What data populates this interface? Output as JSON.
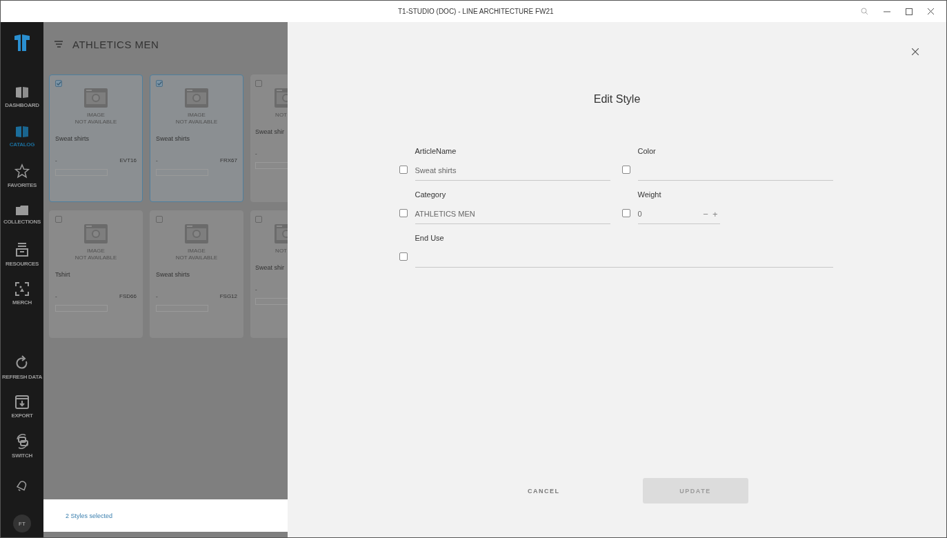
{
  "window": {
    "title": "T1-STUDIO (DOC) - LINE ARCHITECTURE FW21"
  },
  "sidebar": {
    "items": [
      {
        "label": "DASHBOARD",
        "selected": false
      },
      {
        "label": "CATALOG",
        "selected": true
      },
      {
        "label": "FAVORITES",
        "selected": false
      },
      {
        "label": "COLLECTIONS",
        "selected": false
      },
      {
        "label": "RESOURCES",
        "selected": false
      },
      {
        "label": "MERCH",
        "selected": false
      }
    ],
    "actions": [
      {
        "label": "REFRESH DATA"
      },
      {
        "label": "EXPORT"
      },
      {
        "label": "SWITCH"
      },
      {
        "kind": "bell"
      }
    ],
    "avatar": "FT"
  },
  "catalog": {
    "title": "ATHLETICS MEN",
    "cards": [
      {
        "checked": true,
        "image_text": [
          "IMAGE",
          "NOT AVAILABLE"
        ],
        "name": "Sweat shirts",
        "code_left": "-",
        "code": "EVT16",
        "cut": false
      },
      {
        "checked": true,
        "image_text": [
          "IMAGE",
          "NOT AVAILABLE"
        ],
        "name": "Sweat shirts",
        "code_left": "-",
        "code": "FRX67",
        "cut": false
      },
      {
        "checked": false,
        "image_text": [
          "NOT"
        ],
        "name": "Sweat shir",
        "code_left": "-",
        "cut": true
      },
      {
        "checked": false,
        "image_text": [
          "IMAGE",
          "NOT AVAILABLE"
        ],
        "name": "Tshirt",
        "code_left": "-",
        "code": "FSD66",
        "cut": false
      },
      {
        "checked": false,
        "image_text": [
          "IMAGE",
          "NOT AVAILABLE"
        ],
        "name": "Sweat shirts",
        "code_left": "-",
        "code": "FSG12",
        "cut": false
      },
      {
        "checked": false,
        "image_text": [
          "NOT"
        ],
        "name": "Sweat shir",
        "code_left": "-",
        "cut": true
      }
    ],
    "selection": "2 Styles selected"
  },
  "dialog": {
    "title": "Edit Style",
    "fields": [
      {
        "label": "ArticleName",
        "value": "Sweat shirts",
        "kind": "text",
        "wide": false,
        "checked": false
      },
      {
        "label": "Color",
        "kind": "text",
        "wide": false,
        "checked": false
      },
      {
        "label": "Category",
        "value": "ATHLETICS MEN",
        "kind": "text",
        "wide": false,
        "checked": false
      },
      {
        "label": "Weight",
        "value": "0",
        "kind": "number",
        "wide": false,
        "checked": false,
        "minus": "−",
        "plus": "+"
      },
      {
        "label": "End Use",
        "kind": "text",
        "wide": true,
        "checked": false
      }
    ],
    "buttons": [
      {
        "label": "CANCEL",
        "kind": "flat",
        "disabled": false
      },
      {
        "label": "UPDATE",
        "kind": "raised",
        "disabled": true
      }
    ]
  }
}
